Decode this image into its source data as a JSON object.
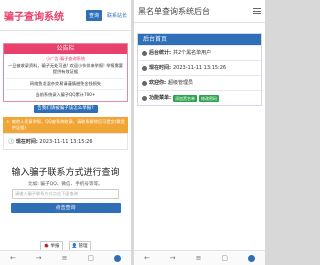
{
  "left": {
    "header": {
      "title": "骗子查询系统",
      "query_button": "查询",
      "contact_link": "联系站长"
    },
    "notice": {
      "title": "公告栏",
      "subtitle": "小广告:骗子查询系统",
      "line1": "一旦被收录资料，骗子无处可逃! 欢迎小伙伴来举报! 举报需要提供有效证据",
      "line2": "网络鱼龙混杂交易请谨慎避免金钱损失",
      "line3": "当前系统录入骗子QQ累计700+"
    },
    "report_button": "告我们请被骗子该怎么举报?",
    "warning": "被他人恶意举报，QQ被系统收录，请联系解除后可提交(需提供证据)",
    "time_label": "现在时间:",
    "time_value": "2023-11-11 13:15:26",
    "main_heading": "输入骗子联系方式进行查询",
    "hint": "比如: 骗子QQ、微信、手机号等等。",
    "input_placeholder": "请输入骗子联系方式点击下面查询",
    "query_button": "点击查询",
    "footer": [
      "举报",
      "管理"
    ]
  },
  "right": {
    "header": {
      "title": "黑名单查询系统后台"
    },
    "panel": {
      "title": "后台首页",
      "stats_label": "后台统计:",
      "stats_value": "共2个黑名单用户",
      "time_label": "现在时间:",
      "time_value": "2023-11-11 13:15:26",
      "role_label": "欢迎你:",
      "role_value": "超级管理员",
      "actions_label": "功能菜单:",
      "actions": [
        "添加黑名单",
        "修改密码"
      ]
    }
  }
}
